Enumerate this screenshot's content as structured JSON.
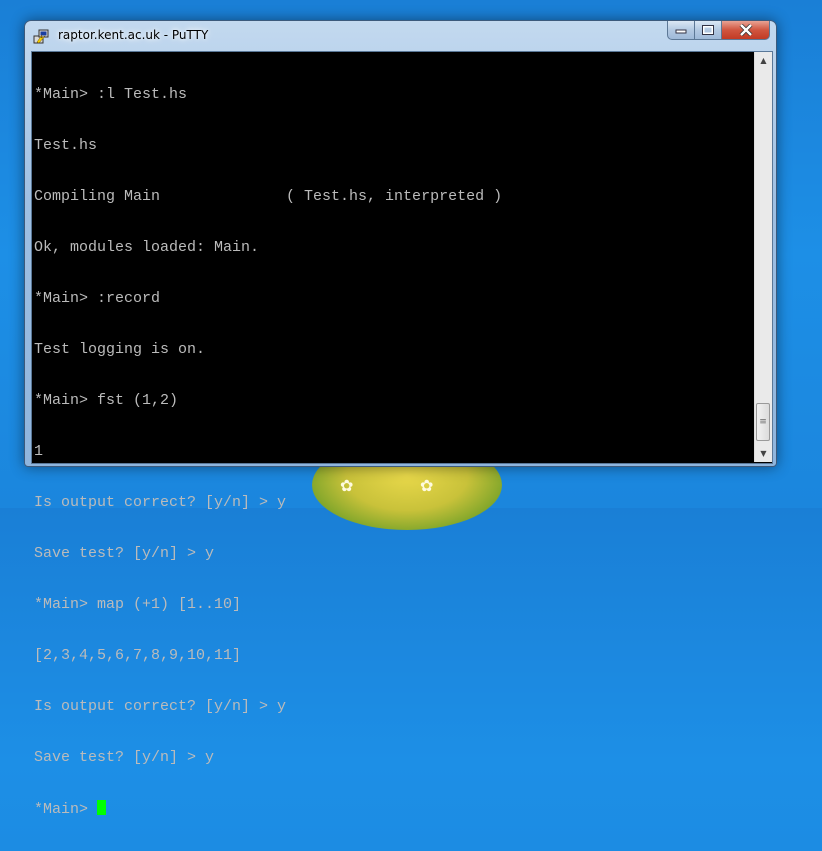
{
  "window": {
    "title": "raptor.kent.ac.uk - PuTTY"
  },
  "controls": {
    "minimize": "minimize",
    "maximize": "maximize",
    "close": "close"
  },
  "terminal": {
    "lines": [
      "*Main> :l Test.hs",
      "Test.hs",
      "Compiling Main              ( Test.hs, interpreted )",
      "Ok, modules loaded: Main.",
      "*Main> :record",
      "Test logging is on.",
      "*Main> fst (1,2)",
      "1",
      "Is output correct? [y/n] > y",
      "Save test? [y/n] > y",
      "*Main> map (+1) [1..10]",
      "[2,3,4,5,6,7,8,9,10,11]",
      "Is output correct? [y/n] > y",
      "Save test? [y/n] > y"
    ],
    "prompt": "*Main> ",
    "cursor_color": "#00ff00"
  },
  "colors": {
    "terminal_bg": "#000000",
    "terminal_fg": "#bbbbbb",
    "desktop": "#1b86dd"
  }
}
